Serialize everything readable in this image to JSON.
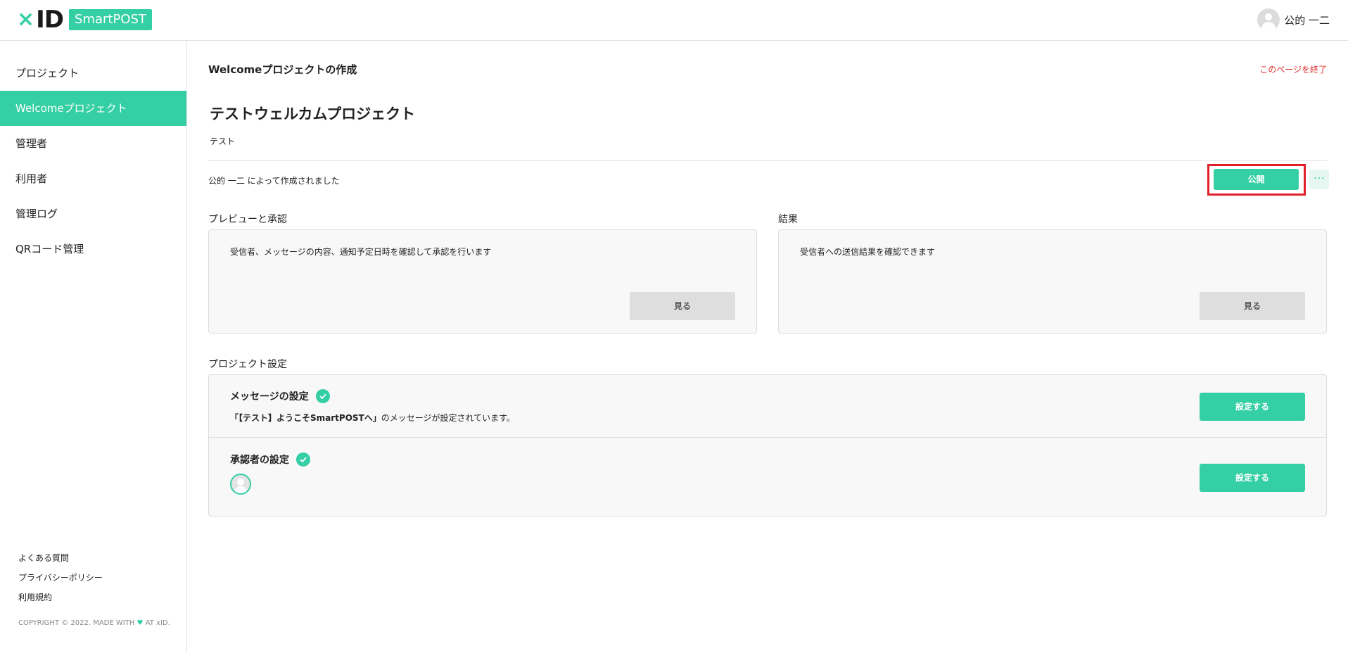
{
  "brand": {
    "logo_x": "×",
    "logo_id": "ID",
    "product": "SmartPOST",
    "accent_color": "#35cfa5"
  },
  "header": {
    "user_name": "公的 一二"
  },
  "sidebar": {
    "items": [
      {
        "label": "プロジェクト",
        "active": false
      },
      {
        "label": "Welcomeプロジェクト",
        "active": true
      },
      {
        "label": "管理者",
        "active": false
      },
      {
        "label": "利用者",
        "active": false
      },
      {
        "label": "管理ログ",
        "active": false
      },
      {
        "label": "QRコード管理",
        "active": false
      }
    ],
    "footer_links": [
      "よくある質問",
      "プライバシーポリシー",
      "利用規約"
    ],
    "copyright_pre": "COPYRIGHT © 2022. MADE WITH",
    "copyright_post": "AT xID."
  },
  "main": {
    "page_title": "Welcomeプロジェクトの作成",
    "exit_link": "このページを終了",
    "project_name": "テストウェルカムプロジェクト",
    "project_description": "テスト",
    "created_by": "公的 一二 によって作成されました",
    "publish_button": "公開",
    "more_button": "⋯",
    "preview": {
      "label": "プレビューと承認",
      "text": "受信者、メッセージの内容、通知予定日時を確認して承認を行います",
      "button": "見る"
    },
    "results": {
      "label": "結果",
      "text": "受信者への送信結果を確認できます",
      "button": "見る"
    },
    "settings": {
      "label": "プロジェクト設定",
      "message": {
        "title": "メッセージの設定",
        "detail_quote": "「【テスト】ようこそSmartPOSTへ」",
        "detail_suffix": "のメッセージが設定されています。",
        "button": "設定する"
      },
      "approver": {
        "title": "承認者の設定",
        "button": "設定する"
      }
    }
  }
}
